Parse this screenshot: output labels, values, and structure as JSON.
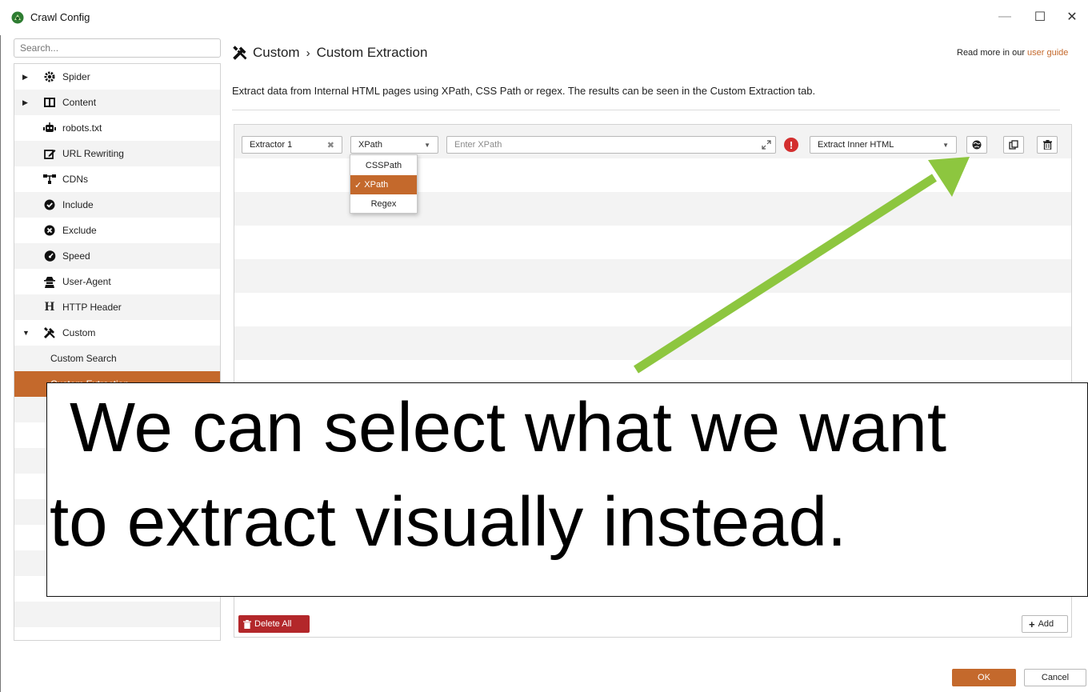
{
  "window": {
    "title": "Crawl Config",
    "controls": {
      "minimize": "—",
      "maximize": "☐",
      "close": "✕"
    }
  },
  "sidebar": {
    "search_placeholder": "Search...",
    "items": [
      {
        "label": "Spider",
        "icon": "gear-icon",
        "expandable": true
      },
      {
        "label": "Content",
        "icon": "columns-icon",
        "expandable": true
      },
      {
        "label": "robots.txt",
        "icon": "robot-icon"
      },
      {
        "label": "URL Rewriting",
        "icon": "edit-icon"
      },
      {
        "label": "CDNs",
        "icon": "network-icon"
      },
      {
        "label": "Include",
        "icon": "check-circle-icon"
      },
      {
        "label": "Exclude",
        "icon": "x-circle-icon"
      },
      {
        "label": "Speed",
        "icon": "gauge-icon"
      },
      {
        "label": "User-Agent",
        "icon": "user-secret-icon"
      },
      {
        "label": "HTTP Header",
        "icon": "header-icon"
      },
      {
        "label": "Custom",
        "icon": "tools-icon",
        "expanded": true
      },
      {
        "label": "Custom Search",
        "sub": true
      },
      {
        "label": "Custom Extraction",
        "sub": true,
        "active": true
      }
    ]
  },
  "main": {
    "breadcrumb": {
      "parent": "Custom",
      "separator": "›",
      "current": "Custom Extraction"
    },
    "read_more": {
      "prefix": "Read more in our ",
      "link": "user guide"
    },
    "description": "Extract data from Internal HTML pages using XPath, CSS Path or regex. The results can be seen in the Custom Extraction tab.",
    "extractor": {
      "name": "Extractor 1",
      "type": "XPath",
      "expression_placeholder": "Enter XPath",
      "extract_mode": "Extract Inner HTML"
    },
    "type_options": [
      "CSSPath",
      "XPath",
      "Regex"
    ],
    "type_selected_mark": "✓",
    "delete_all_label": "Delete All",
    "add_label": "Add"
  },
  "dialog": {
    "ok_label": "OK",
    "cancel_label": "Cancel"
  },
  "annotation": {
    "line1": "We can select what we want",
    "line2": "to extract visually instead.",
    "arrow_color": "#8dc63f"
  },
  "colors": {
    "accent": "#c4692c",
    "danger": "#b3272a",
    "error": "#d32f2f"
  }
}
